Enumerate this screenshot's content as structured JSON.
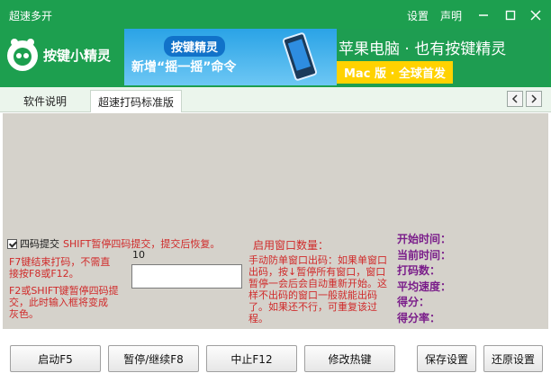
{
  "window": {
    "title": "超速多开",
    "settings_label": "设置",
    "statement_label": "声明"
  },
  "header": {
    "brand": "按键小精灵",
    "banner_left_brand": "按键精灵",
    "banner_left_text": "新增“摇一摇”命令",
    "banner_right_title": "苹果电脑 · 也有按键精灵",
    "banner_right_sub": "Mac 版 · 全球首发"
  },
  "tabs": [
    {
      "label": "软件说明"
    },
    {
      "label": "超速打码标准版"
    }
  ],
  "options": {
    "four_code_checkbox": "四码提交",
    "shift_hint": "SHIFT暂停四码提交，提交后恢复。",
    "f7_line1": "F7键结束打码，不需直",
    "f7_line2": "接按F8或F12。",
    "f2_line1": "F2或SHIFT键暂停四码提",
    "f2_line2": "交，此时输入框将变成",
    "f2_line3": "灰色。",
    "window_count_value": "10",
    "code_input_value": ""
  },
  "window_count": {
    "label": "启用窗口数量：",
    "manual_text": "手动防单窗口出码：如果单窗口出码，按↓暂停所有窗口，窗口暂停一会后会自动重新开始。这样不出码的窗口一般就能出码了。如果还不行，可重复该过程。"
  },
  "stats": {
    "start_time": "开始时间：",
    "current_time": "当前时间：",
    "code_count": "打码数：",
    "avg_speed": "平均速度：",
    "score": "得分：",
    "score_rate": "得分率："
  },
  "buttons": {
    "start": "启动F5",
    "pause": "暂停/继续F8",
    "stop": "中止F12",
    "hotkey": "修改热键",
    "save": "保存设置",
    "restore": "还原设置"
  }
}
